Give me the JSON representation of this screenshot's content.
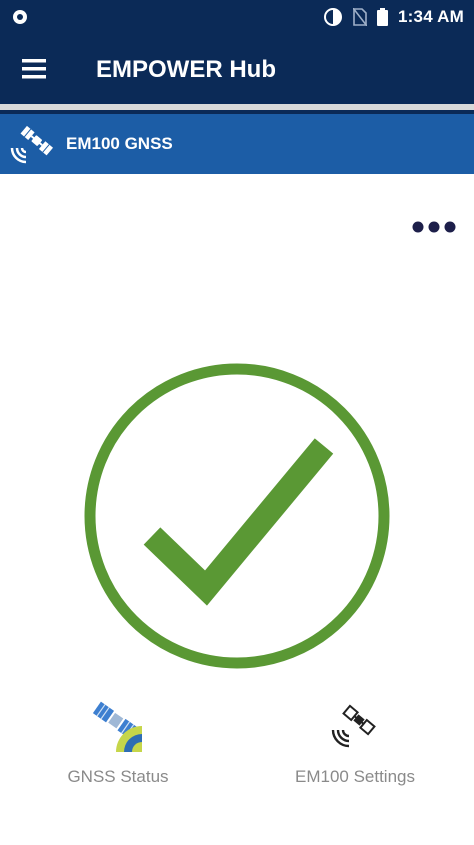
{
  "status_bar": {
    "time": "1:34 AM",
    "icons": [
      "notification-dot-icon",
      "data-saver-icon",
      "no-sim-icon",
      "battery-icon"
    ]
  },
  "app_bar": {
    "title": "EMPOWER Hub",
    "menu_icon": "hamburger-menu-icon"
  },
  "device": {
    "name": "EM100 GNSS",
    "icon": "satellite-icon"
  },
  "overflow_icon": "more-dots-icon",
  "status_indicator": {
    "icon": "check-circle-icon",
    "color": "#5a9834"
  },
  "bottom_nav": [
    {
      "label": "GNSS Status",
      "icon": "gnss-status-icon"
    },
    {
      "label": "EM100 Settings",
      "icon": "satellite-settings-icon"
    }
  ],
  "colors": {
    "header": "#0b2a57",
    "device_bar": "#1c5da6",
    "success": "#5a9834",
    "label_gray": "#8a8a8a"
  }
}
